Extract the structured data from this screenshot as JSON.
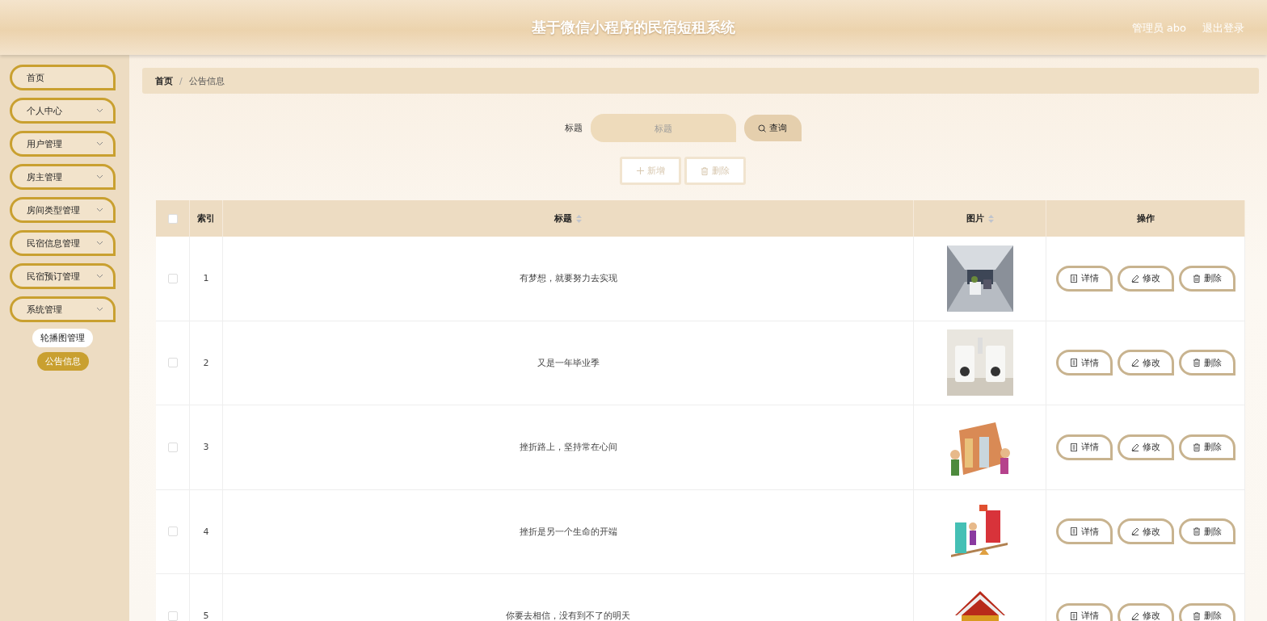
{
  "header": {
    "title": "基于微信小程序的民宿短租系统",
    "user": "管理员 abo",
    "logout": "退出登录"
  },
  "sidebar": {
    "items": [
      {
        "label": "首页",
        "expandable": false
      },
      {
        "label": "个人中心",
        "expandable": true
      },
      {
        "label": "用户管理",
        "expandable": true
      },
      {
        "label": "房主管理",
        "expandable": true
      },
      {
        "label": "房间类型管理",
        "expandable": true
      },
      {
        "label": "民宿信息管理",
        "expandable": true
      },
      {
        "label": "民宿预订管理",
        "expandable": true
      },
      {
        "label": "系统管理",
        "expandable": true,
        "children": [
          {
            "label": "轮播图管理",
            "selected": false
          },
          {
            "label": "公告信息",
            "selected": true
          }
        ]
      }
    ]
  },
  "breadcrumb": {
    "items": [
      "首页",
      "公告信息"
    ],
    "separator": "/"
  },
  "search": {
    "label": "标题",
    "placeholder": "标题",
    "button": "查询"
  },
  "toolbar": {
    "add": "新增",
    "delete": "删除"
  },
  "table": {
    "select_all": {
      "checked": false
    },
    "columns": [
      {
        "label": "索引",
        "sortable": false
      },
      {
        "label": "标题",
        "sortable": true
      },
      {
        "label": "图片",
        "sortable": true
      },
      {
        "label": "操作",
        "sortable": false
      }
    ],
    "rows": [
      {
        "checked": false,
        "index": "1",
        "title": "有梦想，就要努力去实现",
        "image": {
          "kind": "picture"
        },
        "actions": [
          "详情",
          "修改",
          "删除"
        ]
      },
      {
        "checked": false,
        "index": "2",
        "title": "又是一年毕业季",
        "image": {
          "kind": "picture"
        },
        "actions": [
          "详情",
          "修改",
          "删除"
        ]
      },
      {
        "checked": false,
        "index": "3",
        "title": "挫折路上，坚持常在心间",
        "image": {
          "kind": "picture"
        },
        "actions": [
          "详情",
          "修改",
          "删除"
        ]
      },
      {
        "checked": false,
        "index": "4",
        "title": "挫折是另一个生命的开端",
        "image": {
          "kind": "picture"
        },
        "actions": [
          "详情",
          "修改",
          "删除"
        ]
      },
      {
        "checked": false,
        "index": "5",
        "title": "你要去相信，没有到不了的明天",
        "image": {
          "kind": "picture"
        },
        "actions": [
          "详情",
          "修改",
          "删除"
        ]
      }
    ]
  }
}
